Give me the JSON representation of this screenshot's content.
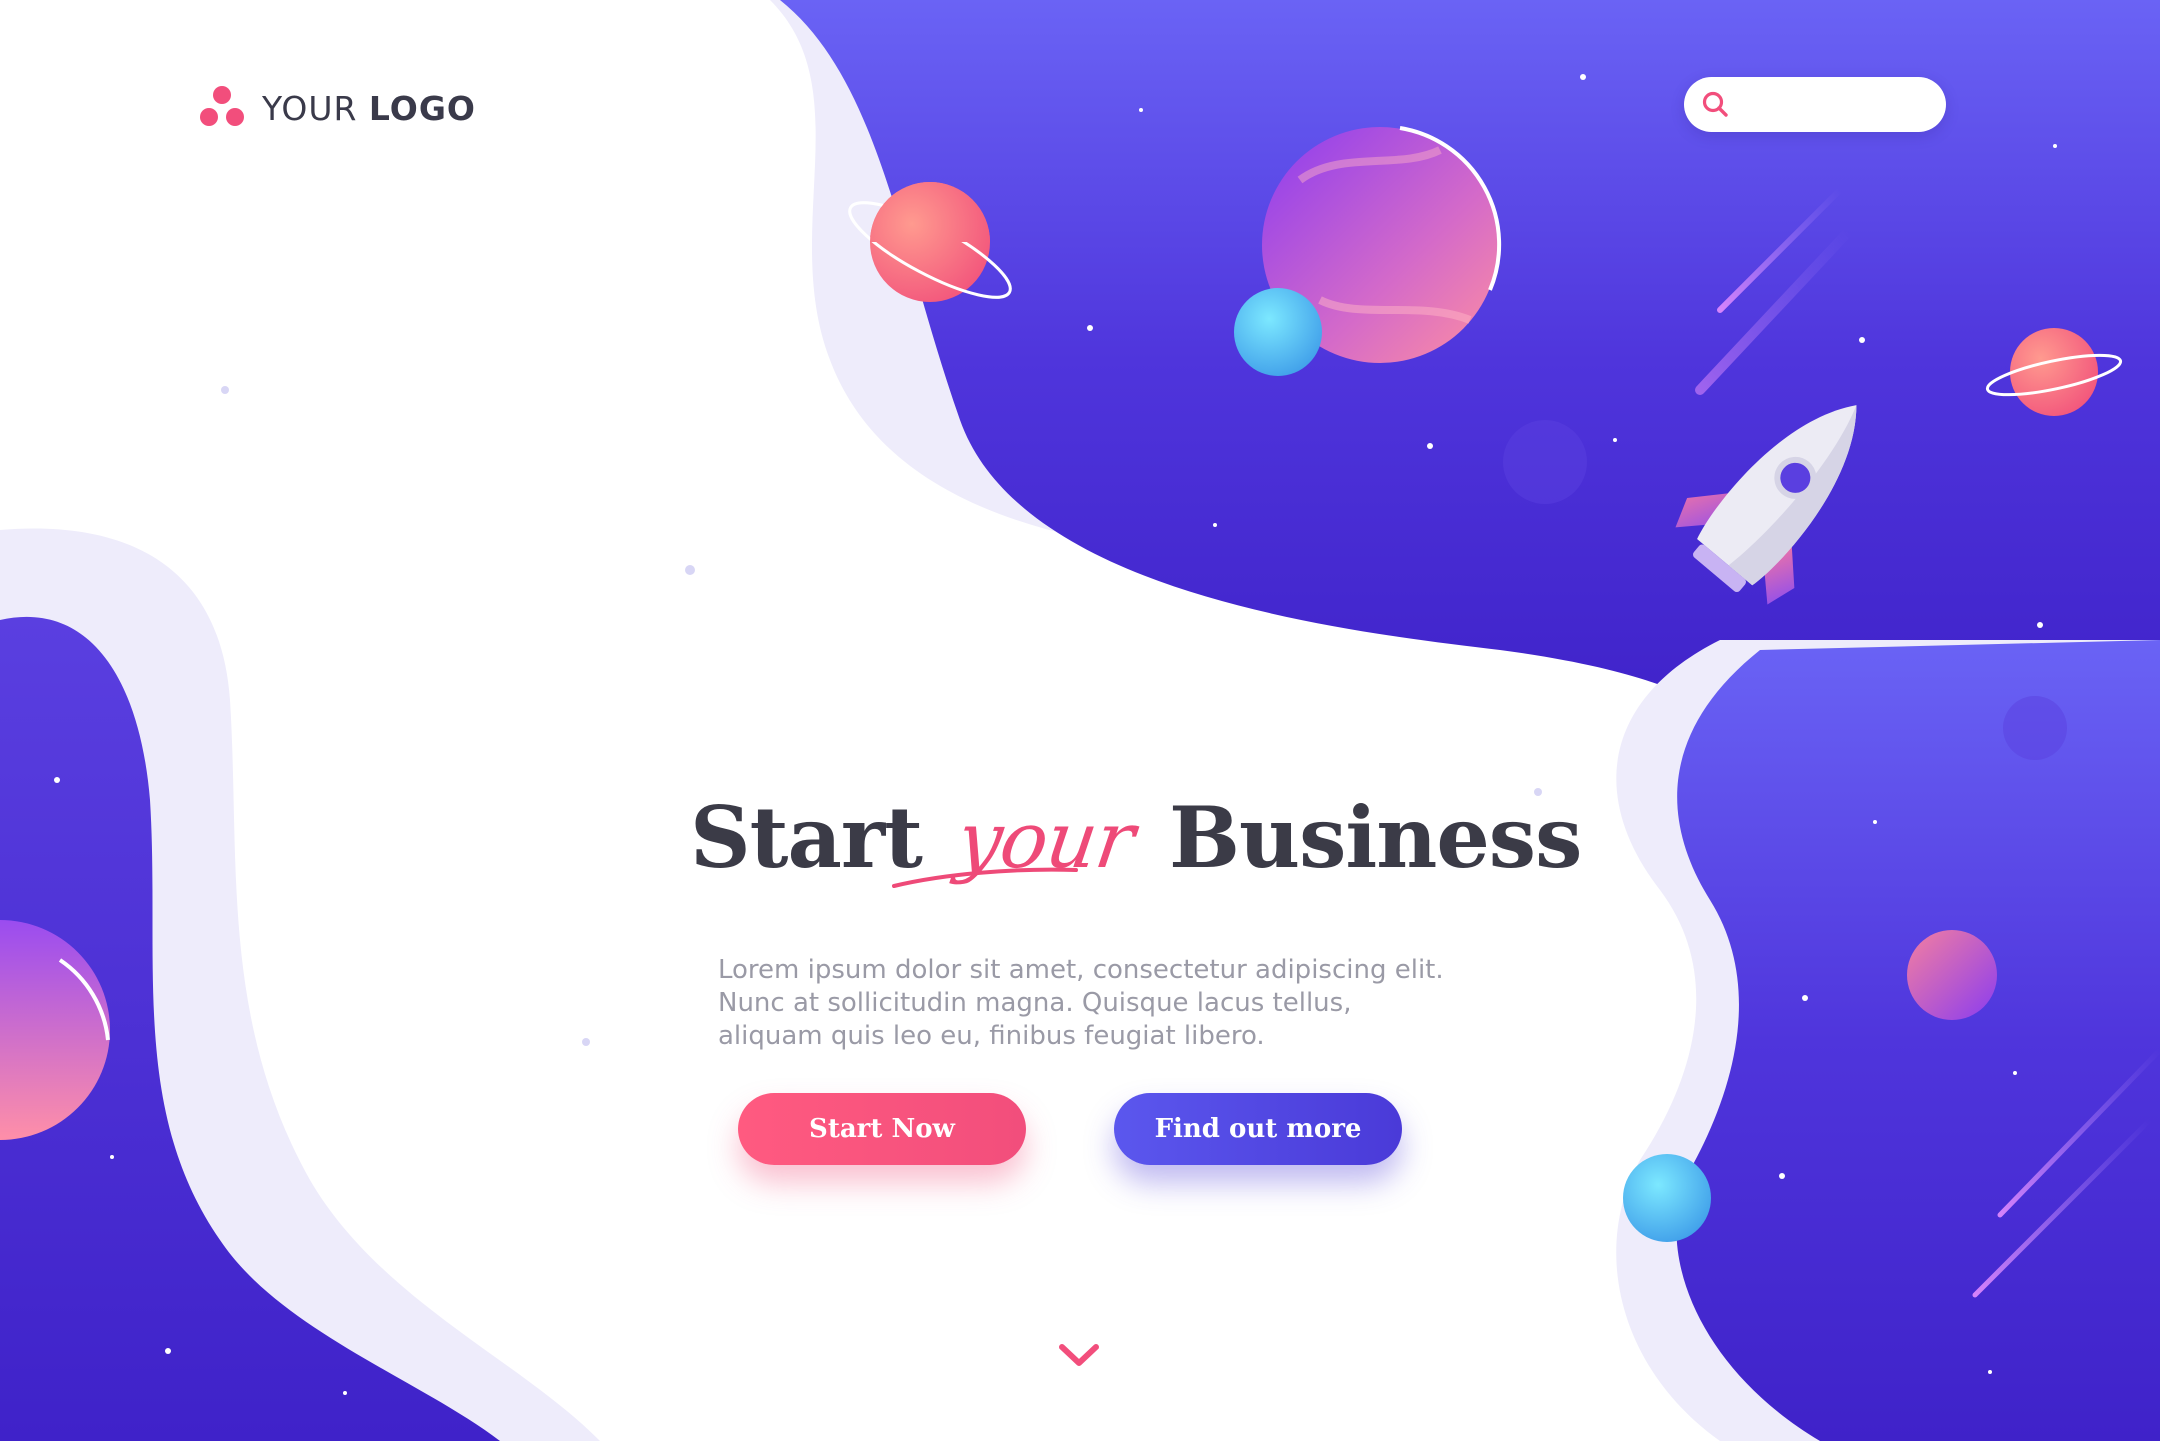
{
  "header": {
    "logo_text_light": "YOUR",
    "logo_text_bold": "LOGO",
    "search_placeholder": "",
    "search_icon": "search-icon"
  },
  "hero": {
    "headline_start": "Start",
    "headline_accent": "your",
    "headline_end": "Business",
    "body": "Lorem ipsum dolor sit amet, consectetur adipiscing elit. Nunc at sollicitudin magna. Quisque lacus tellus, aliquam quis leo eu, finibus feugiat libero.",
    "primary_button": "Start Now",
    "secondary_button": "Find out more",
    "scroll_icon": "chevron-down-icon"
  },
  "colors": {
    "primary_pink": "#f24e7c",
    "primary_purple": "#4a3ad8",
    "deep_space": "#4527d0",
    "text_dark": "#3b3b47",
    "text_muted": "#9a9aa6",
    "planet_cyan": "#4fc6f2"
  },
  "illustration": {
    "icons": [
      "planet-ringed-icon",
      "planet-large-icon",
      "moon-cyan-icon",
      "rocket-icon",
      "star-icon",
      "shooting-star-icon"
    ]
  }
}
